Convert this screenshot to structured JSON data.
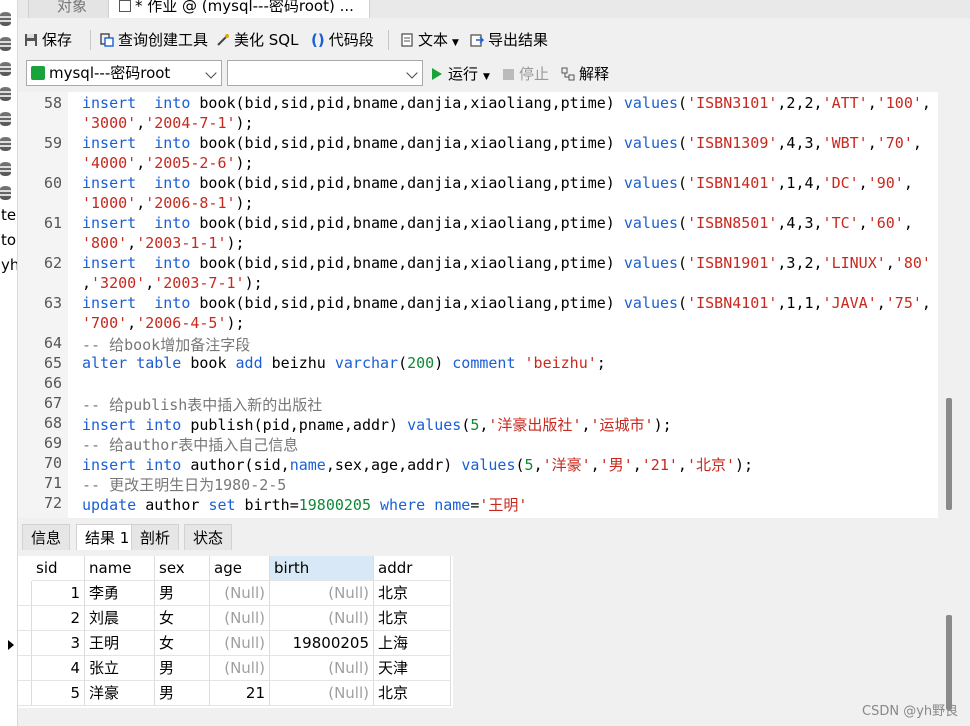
{
  "sidebar": {
    "texts": [
      "te",
      "to",
      "yh"
    ]
  },
  "tabs": [
    {
      "label": "对象"
    },
    {
      "label": "* 作业 @ (mysql---密码root) ..."
    }
  ],
  "toolbar": {
    "save": "保存",
    "query_builder": "查询创建工具",
    "beautify": "美化 SQL",
    "snippet": "代码段",
    "text": "文本",
    "export": "导出结果"
  },
  "connection": {
    "selected": "mysql---密码root",
    "database": "",
    "run": "运行",
    "stop": "停止",
    "explain": "解释"
  },
  "editor": {
    "lines": [
      {
        "no": "58",
        "parts": [
          [
            "kw",
            "insert"
          ],
          [
            "",
            "  "
          ],
          [
            "kw",
            "into"
          ],
          [
            "",
            " book(bid,sid,pid,bname,danjia,xiaoliang,ptime) "
          ],
          [
            "kw",
            "values"
          ],
          [
            "",
            "("
          ],
          [
            "str",
            "'ISBN3101'"
          ],
          [
            "",
            ",2,2,"
          ],
          [
            "str",
            "'ATT'"
          ],
          [
            "",
            ","
          ],
          [
            "str",
            "'100'"
          ],
          [
            "",
            ","
          ]
        ]
      },
      {
        "no": "",
        "parts": [
          [
            "str",
            "'3000'"
          ],
          [
            "",
            ","
          ],
          [
            "str",
            "'2004-7-1'"
          ],
          [
            "",
            ");"
          ]
        ]
      },
      {
        "no": "59",
        "parts": [
          [
            "kw",
            "insert"
          ],
          [
            "",
            "  "
          ],
          [
            "kw",
            "into"
          ],
          [
            "",
            " book(bid,sid,pid,bname,danjia,xiaoliang,ptime) "
          ],
          [
            "kw",
            "values"
          ],
          [
            "",
            "("
          ],
          [
            "str",
            "'ISBN1309'"
          ],
          [
            "",
            ",4,3,"
          ],
          [
            "str",
            "'WBT'"
          ],
          [
            "",
            ","
          ],
          [
            "str",
            "'70'"
          ],
          [
            "",
            ","
          ]
        ]
      },
      {
        "no": "",
        "parts": [
          [
            "str",
            "'4000'"
          ],
          [
            "",
            ","
          ],
          [
            "str",
            "'2005-2-6'"
          ],
          [
            "",
            ");"
          ]
        ]
      },
      {
        "no": "60",
        "parts": [
          [
            "kw",
            "insert"
          ],
          [
            "",
            "  "
          ],
          [
            "kw",
            "into"
          ],
          [
            "",
            " book(bid,sid,pid,bname,danjia,xiaoliang,ptime) "
          ],
          [
            "kw",
            "values"
          ],
          [
            "",
            "("
          ],
          [
            "str",
            "'ISBN1401'"
          ],
          [
            "",
            ",1,4,"
          ],
          [
            "str",
            "'DC'"
          ],
          [
            "",
            ","
          ],
          [
            "str",
            "'90'"
          ],
          [
            "",
            ","
          ]
        ]
      },
      {
        "no": "",
        "parts": [
          [
            "str",
            "'1000'"
          ],
          [
            "",
            ","
          ],
          [
            "str",
            "'2006-8-1'"
          ],
          [
            "",
            ");"
          ]
        ]
      },
      {
        "no": "61",
        "parts": [
          [
            "kw",
            "insert"
          ],
          [
            "",
            "  "
          ],
          [
            "kw",
            "into"
          ],
          [
            "",
            " book(bid,sid,pid,bname,danjia,xiaoliang,ptime) "
          ],
          [
            "kw",
            "values"
          ],
          [
            "",
            "("
          ],
          [
            "str",
            "'ISBN8501'"
          ],
          [
            "",
            ",4,3,"
          ],
          [
            "str",
            "'TC'"
          ],
          [
            "",
            ","
          ],
          [
            "str",
            "'60'"
          ],
          [
            "",
            ","
          ]
        ]
      },
      {
        "no": "",
        "parts": [
          [
            "str",
            "'800'"
          ],
          [
            "",
            ","
          ],
          [
            "str",
            "'2003-1-1'"
          ],
          [
            "",
            ");"
          ]
        ]
      },
      {
        "no": "62",
        "parts": [
          [
            "kw",
            "insert"
          ],
          [
            "",
            "  "
          ],
          [
            "kw",
            "into"
          ],
          [
            "",
            " book(bid,sid,pid,bname,danjia,xiaoliang,ptime) "
          ],
          [
            "kw",
            "values"
          ],
          [
            "",
            "("
          ],
          [
            "str",
            "'ISBN1901'"
          ],
          [
            "",
            ",3,2,"
          ],
          [
            "str",
            "'LINUX'"
          ],
          [
            "",
            ","
          ],
          [
            "str",
            "'80'"
          ]
        ]
      },
      {
        "no": "",
        "parts": [
          [
            "",
            ","
          ],
          [
            "str",
            "'3200'"
          ],
          [
            "",
            ","
          ],
          [
            "str",
            "'2003-7-1'"
          ],
          [
            "",
            ");"
          ]
        ]
      },
      {
        "no": "63",
        "parts": [
          [
            "kw",
            "insert"
          ],
          [
            "",
            "  "
          ],
          [
            "kw",
            "into"
          ],
          [
            "",
            " book(bid,sid,pid,bname,danjia,xiaoliang,ptime) "
          ],
          [
            "kw",
            "values"
          ],
          [
            "",
            "("
          ],
          [
            "str",
            "'ISBN4101'"
          ],
          [
            "",
            ",1,1,"
          ],
          [
            "str",
            "'JAVA'"
          ],
          [
            "",
            ","
          ],
          [
            "str",
            "'75'"
          ],
          [
            "",
            ","
          ]
        ]
      },
      {
        "no": "",
        "parts": [
          [
            "str",
            "'700'"
          ],
          [
            "",
            ","
          ],
          [
            "str",
            "'2006-4-5'"
          ],
          [
            "",
            ");"
          ]
        ]
      },
      {
        "no": "64",
        "parts": [
          [
            "cm",
            "-- 给book增加备注字段"
          ]
        ]
      },
      {
        "no": "65",
        "parts": [
          [
            "kw",
            "alter"
          ],
          [
            "",
            " "
          ],
          [
            "kw",
            "table"
          ],
          [
            "",
            " book "
          ],
          [
            "kw",
            "add"
          ],
          [
            "",
            " beizhu "
          ],
          [
            "kw",
            "varchar"
          ],
          [
            "",
            "("
          ],
          [
            "num",
            "200"
          ],
          [
            "",
            ") "
          ],
          [
            "kw",
            "comment"
          ],
          [
            "",
            " "
          ],
          [
            "str",
            "'beizhu'"
          ],
          [
            "",
            ";"
          ]
        ]
      },
      {
        "no": "66",
        "parts": []
      },
      {
        "no": "67",
        "parts": [
          [
            "cm",
            "-- 给publish表中插入新的出版社"
          ]
        ]
      },
      {
        "no": "68",
        "parts": [
          [
            "kw",
            "insert"
          ],
          [
            "",
            " "
          ],
          [
            "kw",
            "into"
          ],
          [
            "",
            " publish(pid,pname,addr) "
          ],
          [
            "kw",
            "values"
          ],
          [
            "",
            "("
          ],
          [
            "num",
            "5"
          ],
          [
            "",
            ","
          ],
          [
            "str",
            "'洋豪出版社'"
          ],
          [
            "",
            ","
          ],
          [
            "str",
            "'运城市'"
          ],
          [
            "",
            ");"
          ]
        ]
      },
      {
        "no": "69",
        "parts": [
          [
            "cm",
            "-- 给author表中插入自己信息"
          ]
        ]
      },
      {
        "no": "70",
        "parts": [
          [
            "kw",
            "insert"
          ],
          [
            "",
            " "
          ],
          [
            "kw",
            "into"
          ],
          [
            "",
            " author(sid,"
          ],
          [
            "kw",
            "name"
          ],
          [
            "",
            ",sex,age,addr) "
          ],
          [
            "kw",
            "values"
          ],
          [
            "",
            "("
          ],
          [
            "num",
            "5"
          ],
          [
            "",
            ","
          ],
          [
            "str",
            "'洋豪'"
          ],
          [
            "",
            ","
          ],
          [
            "str",
            "'男'"
          ],
          [
            "",
            ","
          ],
          [
            "str",
            "'21'"
          ],
          [
            "",
            ","
          ],
          [
            "str",
            "'北京'"
          ],
          [
            "",
            ");"
          ]
        ]
      },
      {
        "no": "71",
        "parts": [
          [
            "cm",
            "-- 更改王明生日为1980-2-5"
          ]
        ]
      },
      {
        "no": "72",
        "parts": [
          [
            "kw",
            "update"
          ],
          [
            "",
            " author "
          ],
          [
            "kw",
            "set"
          ],
          [
            "",
            " birth="
          ],
          [
            "num",
            "19800205"
          ],
          [
            "",
            " "
          ],
          [
            "kw",
            "where"
          ],
          [
            "",
            " "
          ],
          [
            "kw",
            "name"
          ],
          [
            "",
            "="
          ],
          [
            "str",
            "'王明'"
          ]
        ]
      }
    ]
  },
  "result_tabs": [
    "信息",
    "结果 1",
    "剖析",
    "状态"
  ],
  "grid": {
    "columns": [
      "sid",
      "name",
      "sex",
      "age",
      "birth",
      "addr"
    ],
    "rows": [
      [
        "1",
        "李勇",
        "男",
        "(Null)",
        "(Null)",
        "北京"
      ],
      [
        "2",
        "刘晨",
        "女",
        "(Null)",
        "(Null)",
        "北京"
      ],
      [
        "3",
        "王明",
        "女",
        "(Null)",
        "19800205",
        "上海"
      ],
      [
        "4",
        "张立",
        "男",
        "(Null)",
        "(Null)",
        "天津"
      ],
      [
        "5",
        "洋豪",
        "男",
        "21",
        "(Null)",
        "北京"
      ]
    ]
  },
  "watermark": "CSDN @yh野良",
  "colors": {
    "keyword": "#1a5fd6",
    "string": "#c8281e",
    "number": "#0b8a35",
    "comment": "#777777",
    "run": "#1aa33a"
  }
}
